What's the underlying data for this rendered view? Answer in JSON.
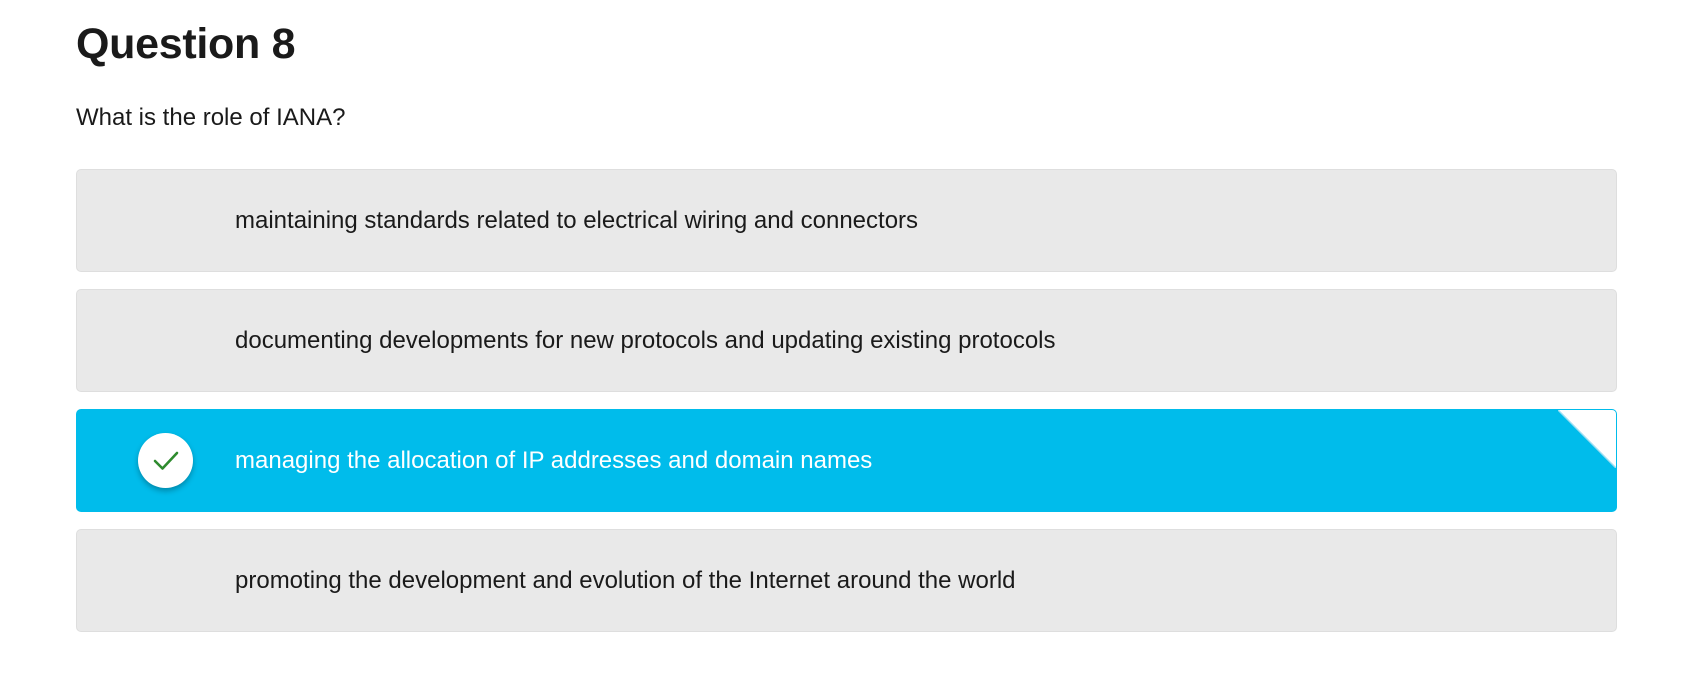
{
  "question": {
    "title": "Question 8",
    "prompt": "What is the role of IANA?"
  },
  "options": [
    {
      "text": "maintaining standards related to electrical wiring and connectors",
      "selected": false
    },
    {
      "text": "documenting developments for new protocols and updating existing protocols",
      "selected": false
    },
    {
      "text": "managing the allocation of IP addresses and domain names",
      "selected": true
    },
    {
      "text": "promoting the development and evolution of the Internet around the world",
      "selected": false
    }
  ],
  "icons": {
    "selected_marker": "checkmark-icon",
    "selected_corner": "corner-fold-icon"
  },
  "colors": {
    "option_bg": "#e9e9e9",
    "selected_bg": "#00bceb",
    "check_color": "#2e8b2e",
    "text": "#1a1a1a"
  }
}
